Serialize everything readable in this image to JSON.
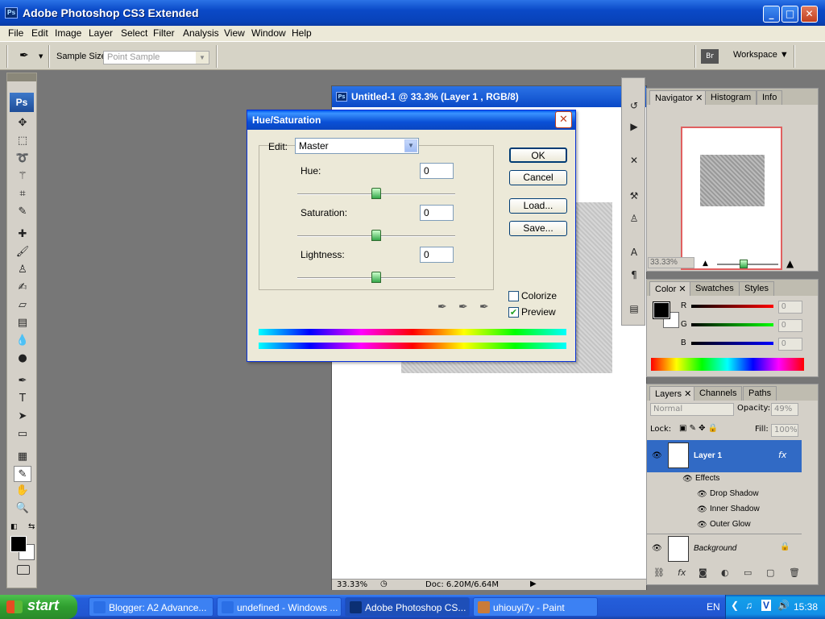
{
  "app": {
    "title": "Adobe Photoshop CS3 Extended"
  },
  "menu": [
    "File",
    "Edit",
    "Image",
    "Layer",
    "Select",
    "Filter",
    "Analysis",
    "View",
    "Window",
    "Help"
  ],
  "options": {
    "sample_size_label": "Sample Size:",
    "sample_size_value": "Point Sample",
    "workspace": "Workspace ▼"
  },
  "toolbox": {
    "logo": "Ps"
  },
  "document": {
    "title": "Untitled-1 @ 33.3% (Layer 1 , RGB/8)",
    "zoom": "33.33%",
    "doc_size": "Doc: 6.20M/6.64M"
  },
  "dialog": {
    "title": "Hue/Saturation",
    "edit_label": "Edit:",
    "edit_value": "Master",
    "hue_label": "Hue:",
    "hue_value": "0",
    "saturation_label": "Saturation:",
    "saturation_value": "0",
    "lightness_label": "Lightness:",
    "lightness_value": "0",
    "ok": "OK",
    "cancel": "Cancel",
    "load": "Load...",
    "save": "Save...",
    "colorize_label": "Colorize",
    "colorize_checked": false,
    "preview_label": "Preview",
    "preview_checked": true
  },
  "navigator": {
    "tabs": [
      "Navigator",
      "Histogram",
      "Info"
    ],
    "zoom": "33.33%"
  },
  "color_panel": {
    "tabs": [
      "Color",
      "Swatches",
      "Styles"
    ],
    "r_label": "R",
    "g_label": "G",
    "b_label": "B",
    "r": "0",
    "g": "0",
    "b": "0"
  },
  "layers_panel": {
    "tabs": [
      "Layers",
      "Channels",
      "Paths"
    ],
    "blend_mode": "Normal",
    "opacity_label": "Opacity:",
    "opacity": "49%",
    "lock_label": "Lock:",
    "fill_label": "Fill:",
    "fill": "100%",
    "layer1": "Layer 1",
    "effects_label": "Effects",
    "effects": [
      "Drop Shadow",
      "Inner Shadow",
      "Outer Glow"
    ],
    "background": "Background"
  },
  "taskbar": {
    "start": "start",
    "tasks": [
      "Blogger: A2 Advance...",
      "undefined - Windows ...",
      "Adobe Photoshop CS...",
      "uhiouyi7y - Paint"
    ],
    "lang": "EN",
    "time": "15:38"
  }
}
